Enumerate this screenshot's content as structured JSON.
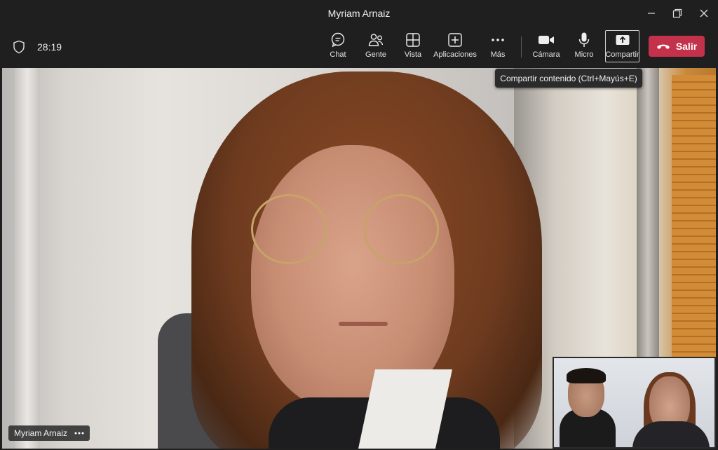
{
  "window": {
    "title": "Myriam Arnaiz"
  },
  "toolbar": {
    "timer": "28:19",
    "chat_label": "Chat",
    "people_label": "Gente",
    "view_label": "Vista",
    "apps_label": "Aplicaciones",
    "more_label": "Más",
    "camera_label": "Cámara",
    "mic_label": "Micro",
    "share_label": "Compartir",
    "leave_label": "Salir"
  },
  "tooltip": {
    "text": "Compartir contenido (Ctrl+Mayús+E)"
  },
  "participant": {
    "name": "Myriam Arnaiz"
  },
  "colors": {
    "leave": "#c4314b",
    "background": "#1f1f1f",
    "tooltip": "#2b2b2b"
  }
}
